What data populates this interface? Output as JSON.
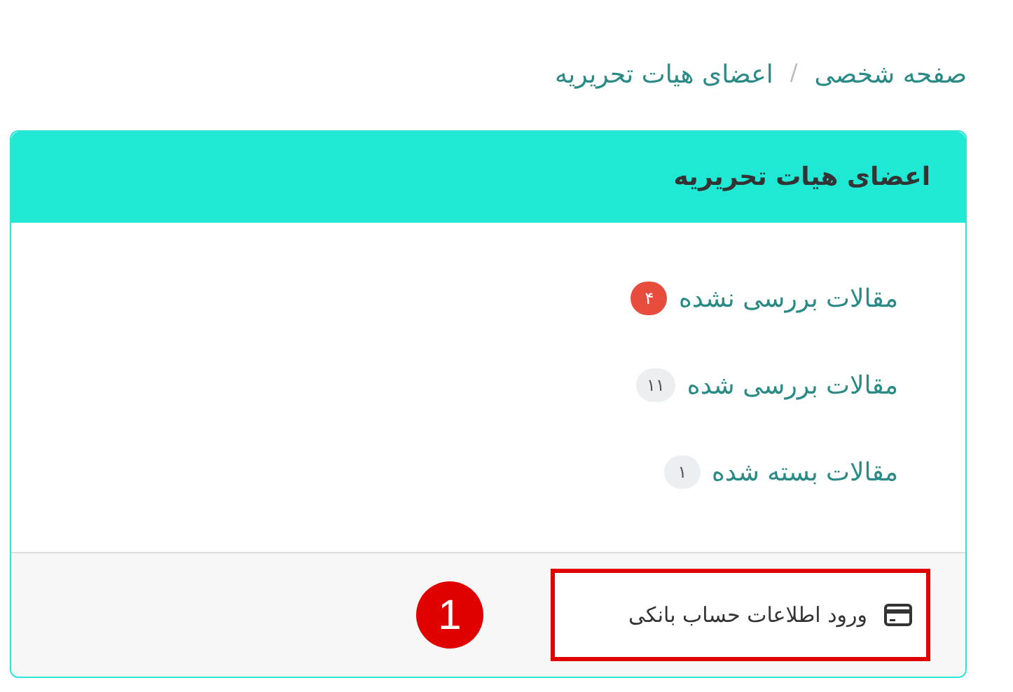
{
  "breadcrumb": [
    {
      "label": "صفحه شخصی"
    },
    {
      "label": "/"
    },
    {
      "label": "اعضای هیات تحریریه"
    }
  ],
  "card": {
    "title": "اعضای هیات تحریریه",
    "items": [
      {
        "label": "مقالات بررسی نشده",
        "count": "۴",
        "color": "#e74c3c"
      },
      {
        "label": "مقالات بررسی شده",
        "count": "۱۱",
        "color": "#eceff1"
      },
      {
        "label": "مقالات بسته شده",
        "count": "۱",
        "color": "#eceff1"
      }
    ],
    "footer_link": {
      "label": "ورود اطلاعات حساب بانکی"
    }
  },
  "annotation": {
    "label": "1"
  }
}
